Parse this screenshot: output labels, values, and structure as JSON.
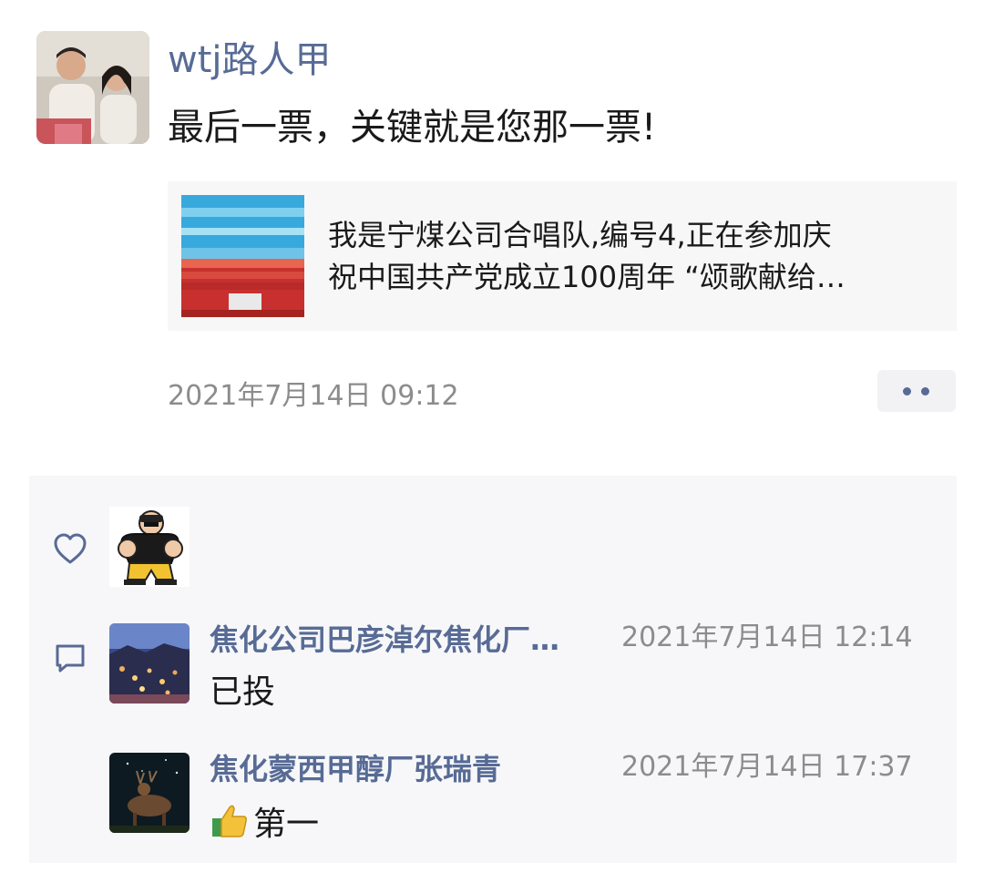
{
  "post": {
    "author_name": "wtj路人甲",
    "text": "最后一票，关键就是您那一票!",
    "link": {
      "title_line1": "我是宁煤公司合唱队,编号4,正在参加庆",
      "title_line2": "祝中国共产党成立100周年 “颂歌献给…"
    },
    "timestamp": "2021年7月14日 09:12"
  },
  "likes": {
    "icon": "heart-icon"
  },
  "comments_icon": "comment-icon",
  "comments": [
    {
      "name": "焦化公司巴彦淖尔焦化厂…",
      "time": "2021年7月14日 12:14",
      "text": "已投"
    },
    {
      "name": "焦化蒙西甲醇厂张瑞青",
      "time": "2021年7月14日 17:37",
      "emoji": "thumbs-up-emoji",
      "text": "第一"
    }
  ],
  "colors": {
    "link_blue": "#576b95",
    "text": "#1a1a1a",
    "meta_gray": "#8c8c8c",
    "panel_bg": "#f7f7f9",
    "card_bg": "#f7f7f7"
  }
}
